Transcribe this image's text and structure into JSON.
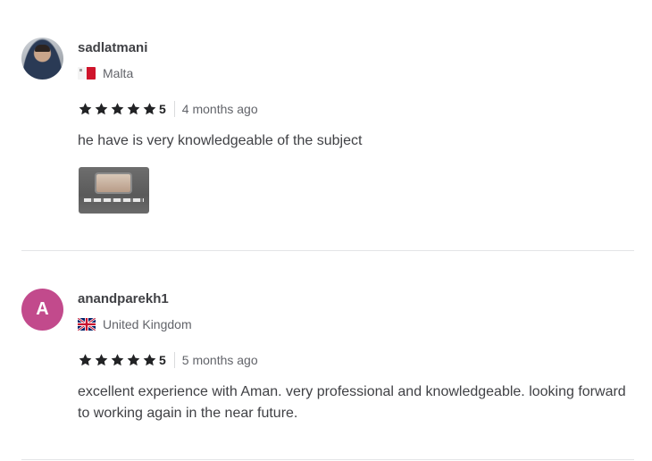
{
  "reviews": [
    {
      "username": "sadlatmani",
      "avatar_type": "photo",
      "country": "Malta",
      "flag_icon": "malta-flag-icon",
      "rating": "5",
      "stars": 5,
      "time": "4 months ago",
      "text": "he have is very knowledgeable of the subject",
      "has_attachment": true
    },
    {
      "username": "anandparekh1",
      "avatar_type": "letter",
      "avatar_letter": "A",
      "avatar_color": "#c24a8c",
      "country": "United Kingdom",
      "flag_icon": "uk-flag-icon",
      "rating": "5",
      "stars": 5,
      "time": "5 months ago",
      "text": "excellent experience with Aman. very professional and knowledgeable. looking forward to working again in the near future.",
      "has_attachment": false
    }
  ],
  "colors": {
    "star": "#222325",
    "divider": "#e4e5e7",
    "text": "#404145",
    "muted": "#62646a"
  }
}
